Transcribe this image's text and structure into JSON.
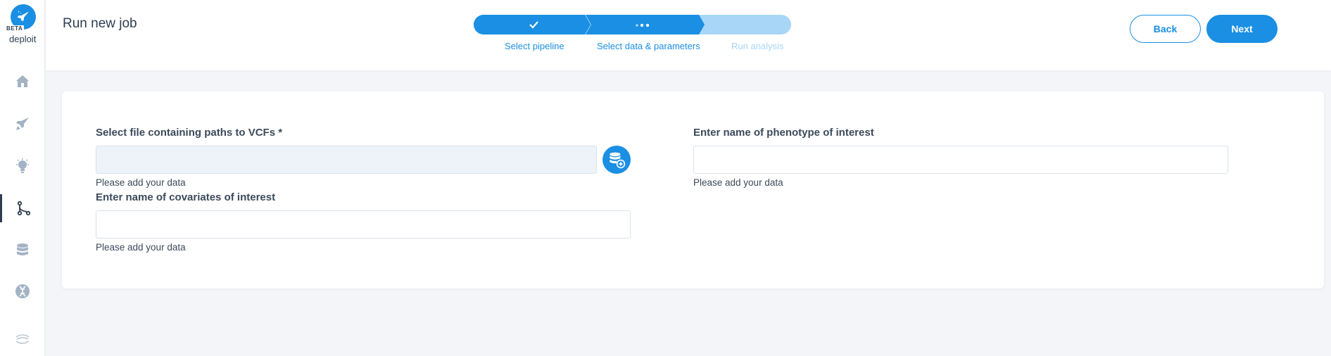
{
  "app": {
    "logo_badge": "BETA",
    "logo_text": "deploit",
    "title": "Run new job"
  },
  "sidebar": {
    "items": [
      {
        "name": "home",
        "icon": "home-icon"
      },
      {
        "name": "pipelines",
        "icon": "rocket-icon"
      },
      {
        "name": "ideas",
        "icon": "lightbulb-icon"
      },
      {
        "name": "jobs",
        "icon": "branch-icon",
        "active": true
      },
      {
        "name": "data",
        "icon": "database-icon"
      },
      {
        "name": "genomics",
        "icon": "dna-icon"
      },
      {
        "name": "public",
        "icon": "globe-icon"
      }
    ]
  },
  "stepper": {
    "steps": [
      {
        "label": "Select pipeline",
        "state": "complete"
      },
      {
        "label": "Select data & parameters",
        "state": "current"
      },
      {
        "label": "Run analysis",
        "state": "pending"
      }
    ]
  },
  "actions": {
    "back_label": "Back",
    "next_label": "Next"
  },
  "form": {
    "vcf_file": {
      "label": "Select file containing paths to VCFs *",
      "value": "",
      "hint": "Please add your data"
    },
    "covariates": {
      "label": "Enter name of covariates of interest",
      "value": "",
      "hint": "Please add your data"
    },
    "phenotype": {
      "label": "Enter name of phenotype of interest",
      "value": "",
      "hint": "Please add your data"
    }
  },
  "colors": {
    "accent": "#1a8fe3",
    "step_pending": "#a8d6f7",
    "text_dark": "#2d3e50",
    "background": "#f3f5f9"
  }
}
